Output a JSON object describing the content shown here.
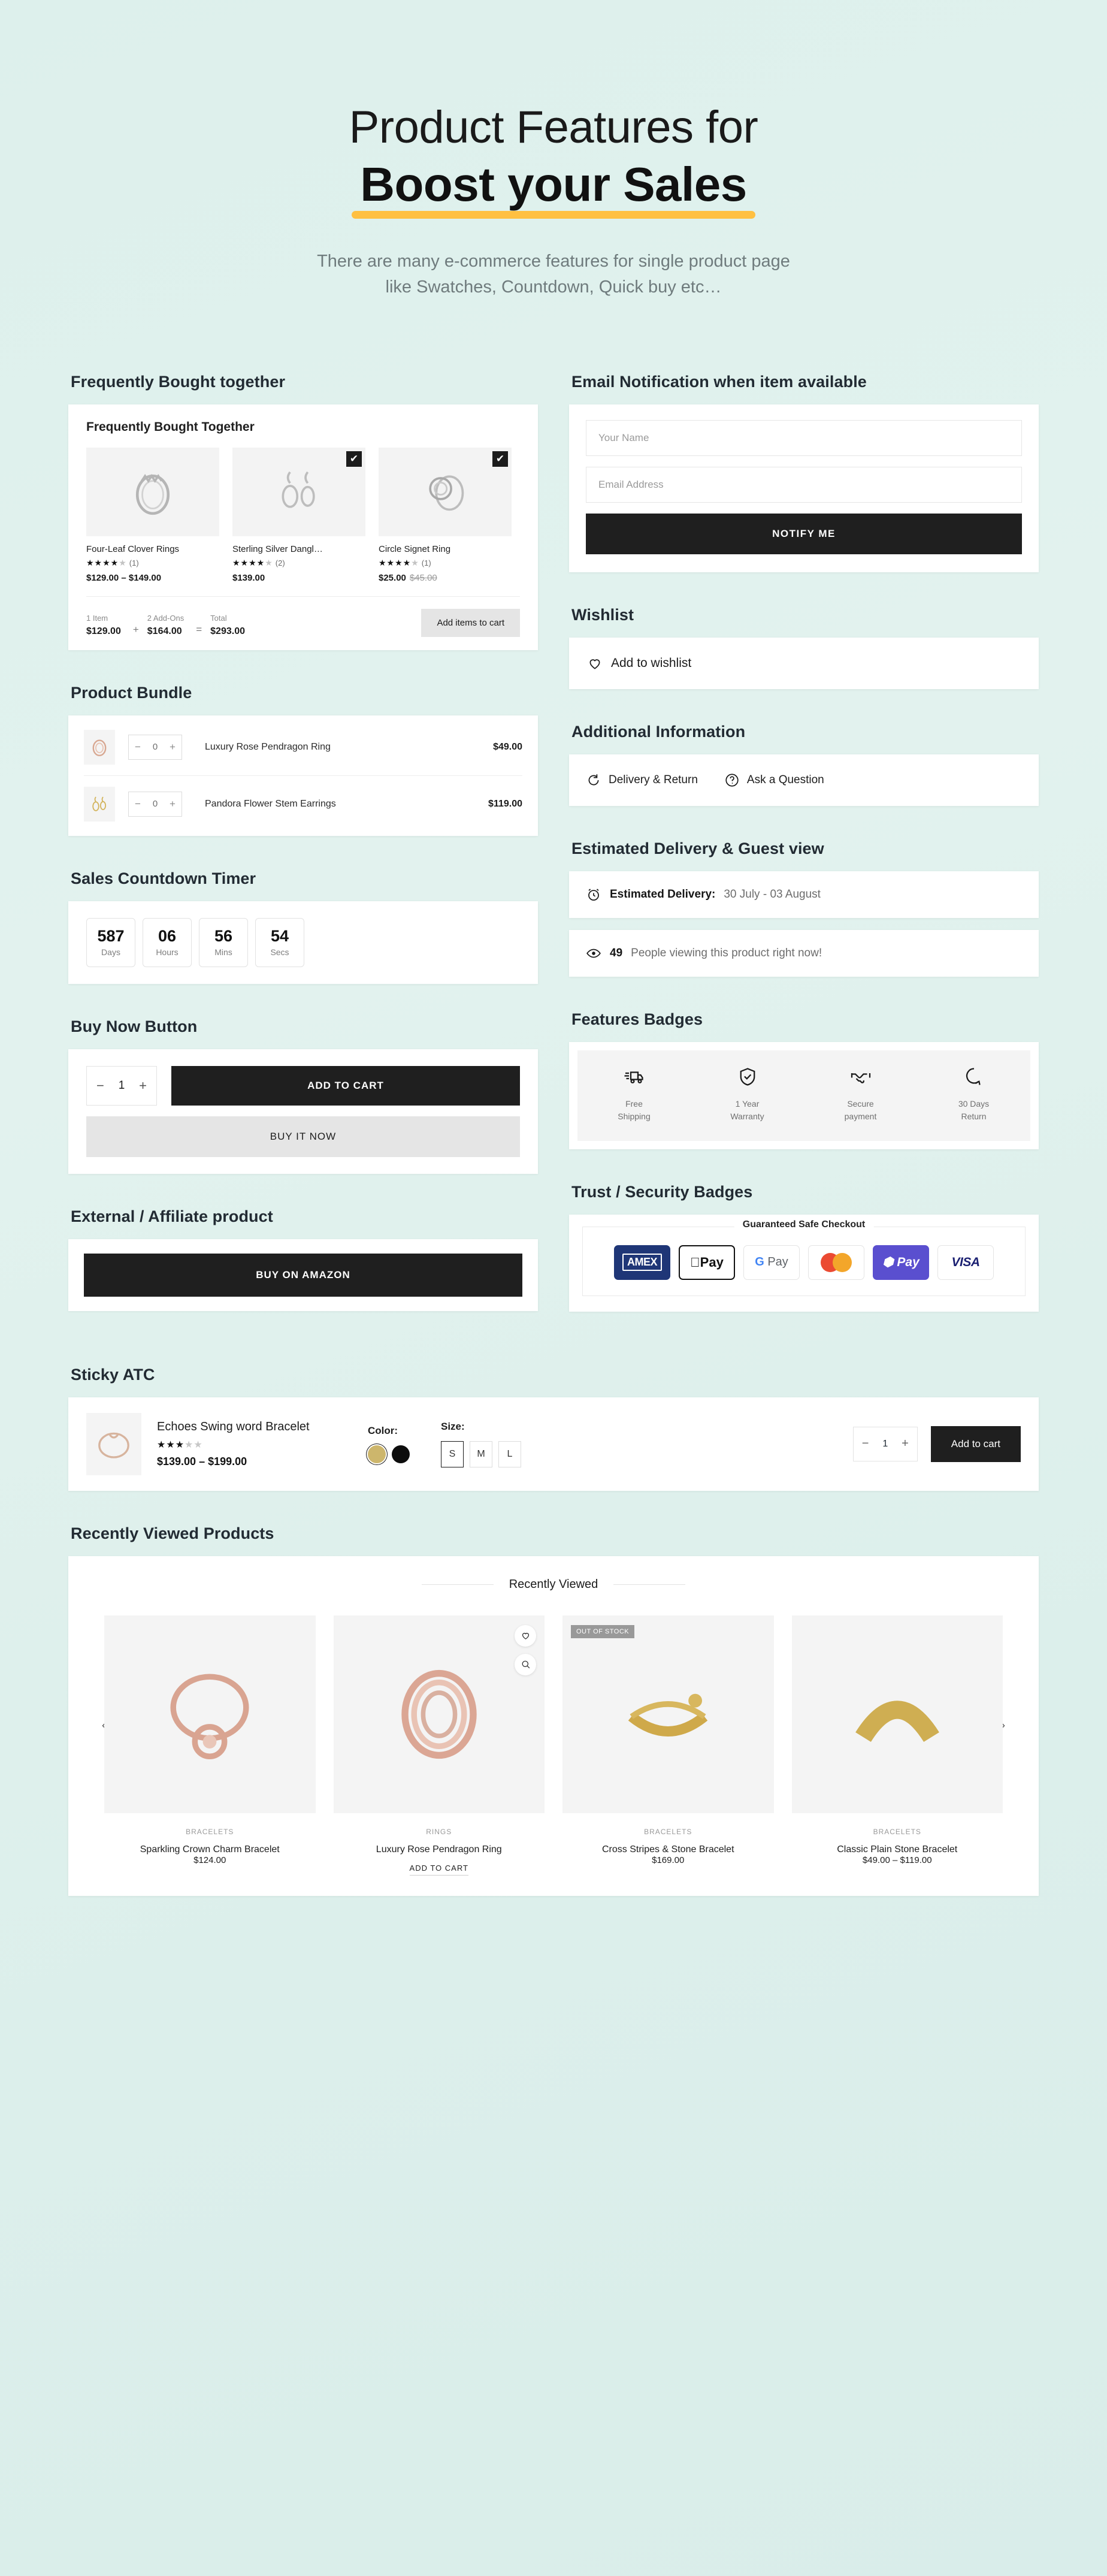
{
  "hero": {
    "line1": "Product Features for",
    "line2": "Boost your Sales",
    "subtitle_line1": "There are many e-commerce features for single product page",
    "subtitle_line2": "like Swatches, Countdown, Quick buy etc…"
  },
  "colors": {
    "background": "#dff0ed",
    "accent_underline": "#ffc042",
    "dark_button": "#1f1f1f",
    "grey_button": "#e5e5e5"
  },
  "frequently_bought": {
    "section_title": "Frequently Bought together",
    "card_title": "Frequently Bought Together",
    "items": [
      {
        "name": "Four-Leaf Clover Rings",
        "stars_on": 4,
        "stars_off": 1,
        "review_count": "(1)",
        "price": "$129.00 – $149.00",
        "old_price": "",
        "checked": false
      },
      {
        "name": "Sterling Silver Dangl…",
        "stars_on": 4,
        "stars_off": 1,
        "review_count": "(2)",
        "price": "$139.00",
        "old_price": "",
        "checked": true
      },
      {
        "name": "Circle Signet Ring",
        "stars_on": 4,
        "stars_off": 1,
        "review_count": "(1)",
        "price": "$25.00",
        "old_price": "$45.00",
        "checked": true
      }
    ],
    "summary": {
      "item_label": "1 Item",
      "item_value": "$129.00",
      "plus": "+",
      "addons_label": "2 Add-Ons",
      "addons_value": "$164.00",
      "equals": "=",
      "total_label": "Total",
      "total_value": "$293.00",
      "button": "Add items to cart"
    }
  },
  "product_bundle": {
    "section_title": "Product Bundle",
    "rows": [
      {
        "qty": "0",
        "name": "Luxury Rose Pendragon Ring",
        "price": "$49.00"
      },
      {
        "qty": "0",
        "name": "Pandora Flower Stem Earrings",
        "price": "$119.00"
      }
    ]
  },
  "countdown": {
    "section_title": "Sales Countdown Timer",
    "units": [
      {
        "value": "587",
        "label": "Days"
      },
      {
        "value": "06",
        "label": "Hours"
      },
      {
        "value": "56",
        "label": "Mins"
      },
      {
        "value": "54",
        "label": "Secs"
      }
    ]
  },
  "buy_now": {
    "section_title": "Buy Now Button",
    "qty": "1",
    "add_to_cart": "ADD TO CART",
    "buy_it_now": "BUY IT NOW"
  },
  "affiliate": {
    "section_title": "External / Affiliate product",
    "button": "BUY ON AMAZON"
  },
  "email_notification": {
    "section_title": "Email Notification when item available",
    "name_placeholder": "Your Name",
    "email_placeholder": "Email Address",
    "button": "NOTIFY ME"
  },
  "wishlist": {
    "section_title": "Wishlist",
    "label": "Add to wishlist"
  },
  "additional_information": {
    "section_title": "Additional Information",
    "items": [
      {
        "label": "Delivery & Return",
        "icon": "refresh-icon"
      },
      {
        "label": "Ask a Question",
        "icon": "question-circle-icon"
      }
    ]
  },
  "estimated_delivery": {
    "section_title": "Estimated Delivery & Guest view",
    "delivery_label": "Estimated Delivery:",
    "delivery_value": "30 July - 03 August",
    "viewers_count": "49",
    "viewers_text": "People viewing this product right now!"
  },
  "features_badges": {
    "section_title": "Features Badges",
    "badges": [
      {
        "icon": "truck-icon",
        "line1": "Free",
        "line2": "Shipping"
      },
      {
        "icon": "shield-check-icon",
        "line1": "1 Year",
        "line2": "Warranty"
      },
      {
        "icon": "handshake-icon",
        "line1": "Secure",
        "line2": "payment"
      },
      {
        "icon": "return-arrow-icon",
        "line1": "30 Days",
        "line2": "Return"
      }
    ]
  },
  "trust_badges": {
    "section_title": "Trust / Security Badges",
    "title": "Guaranteed Safe Checkout",
    "methods": [
      {
        "name": "AMEX",
        "label": "AMEX"
      },
      {
        "name": "Apple Pay",
        "label": "Pay"
      },
      {
        "name": "Google Pay",
        "label": "Pay"
      },
      {
        "name": "Mastercard",
        "label": ""
      },
      {
        "name": "Shop Pay",
        "label": "Pay"
      },
      {
        "name": "VISA",
        "label": "VISA"
      }
    ]
  },
  "sticky_atc": {
    "section_title": "Sticky ATC",
    "product_name": "Echoes Swing word Bracelet",
    "stars_on": 3,
    "stars_off": 2,
    "price": "$139.00 – $199.00",
    "color_label": "Color:",
    "colors": [
      {
        "name": "gold",
        "hex": "#cdb66c",
        "selected": true
      },
      {
        "name": "black",
        "hex": "#0d0d0d",
        "selected": false
      }
    ],
    "size_label": "Size:",
    "sizes": [
      {
        "label": "S",
        "selected": true
      },
      {
        "label": "M",
        "selected": false
      },
      {
        "label": "L",
        "selected": false
      }
    ],
    "qty": "1",
    "add_to_cart": "Add to cart"
  },
  "recently_viewed": {
    "section_title": "Recently Viewed Products",
    "carousel_title": "Recently Viewed",
    "prev_arrow": "‹",
    "next_arrow": "›",
    "products": [
      {
        "category": "BRACELETS",
        "name": "Sparkling Crown Charm Bracelet",
        "price": "$124.00",
        "badge": "",
        "is_atc": false
      },
      {
        "category": "RINGS",
        "name": "Luxury Rose Pendragon Ring",
        "price": "ADD TO CART",
        "badge": "",
        "is_atc": true
      },
      {
        "category": "BRACELETS",
        "name": "Cross Stripes & Stone Bracelet",
        "price": "$169.00",
        "badge": "OUT OF STOCK",
        "is_atc": false
      },
      {
        "category": "BRACELETS",
        "name": "Classic Plain Stone Bracelet",
        "price": "$49.00 – $119.00",
        "badge": "",
        "is_atc": false
      }
    ]
  }
}
